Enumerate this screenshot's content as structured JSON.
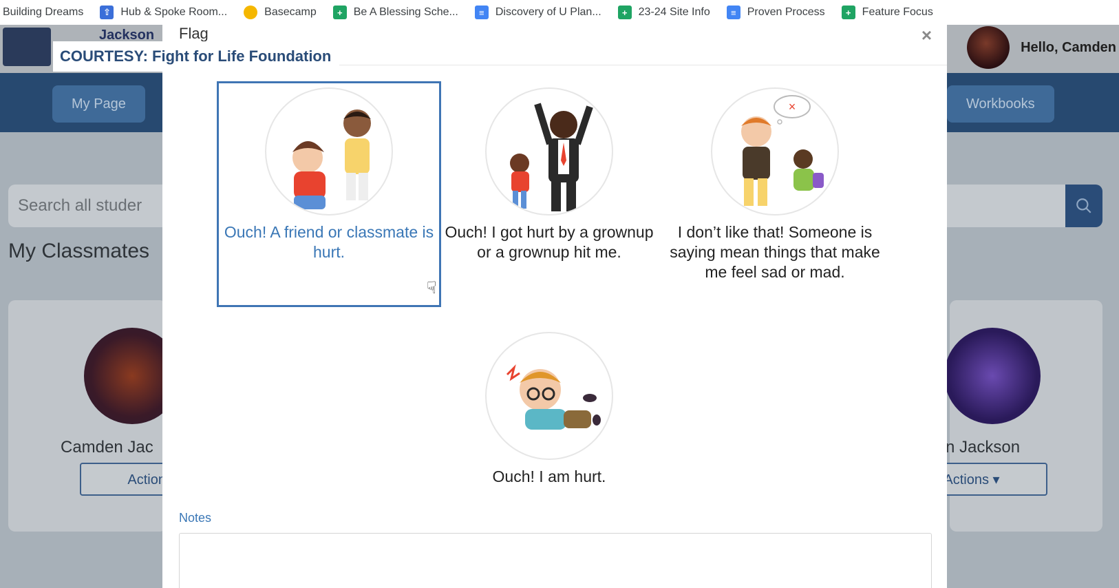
{
  "bookmarks": [
    {
      "label": "Building Dreams",
      "icon": "none"
    },
    {
      "label": "Hub & Spoke Room...",
      "icon": "hub-icon"
    },
    {
      "label": "Basecamp",
      "icon": "basecamp-icon"
    },
    {
      "label": "Be A Blessing Sche...",
      "icon": "sheets-icon"
    },
    {
      "label": "Discovery of U Plan...",
      "icon": "docs-icon"
    },
    {
      "label": "23-24 Site Info",
      "icon": "sheets-icon"
    },
    {
      "label": "Proven Process",
      "icon": "docs-icon"
    },
    {
      "label": "Feature Focus",
      "icon": "sheets-icon"
    }
  ],
  "app": {
    "school_name": "Jackson",
    "greeting": "Hello, Camden",
    "nav": {
      "my_page": "My Page",
      "workbooks": "Workbooks"
    },
    "search_placeholder": "Search all studer",
    "classmates_title": "My Classmates",
    "cards": [
      {
        "name": "Camden Jac",
        "actions": "Actions ▾"
      },
      {
        "name": "ton Jackson",
        "actions": "Actions ▾"
      }
    ]
  },
  "courtesy": "COURTESY: Fight for Life Foundation",
  "modal": {
    "title": "Flag",
    "close": "×",
    "options": [
      {
        "label": "Ouch! A friend or classmate is hurt.",
        "selected": true
      },
      {
        "label": "Ouch! I got hurt by a grownup or a grownup hit me.",
        "selected": false
      },
      {
        "label": "I don’t like that! Someone is saying mean things that make me feel sad or mad.",
        "selected": false
      },
      {
        "label": "Ouch! I am hurt.",
        "selected": false
      }
    ],
    "notes_label": "Notes",
    "notes_value": ""
  },
  "colors": {
    "accent_blue": "#3a77b6",
    "navbar": "#274970",
    "selected_border": "#3f75b4"
  }
}
